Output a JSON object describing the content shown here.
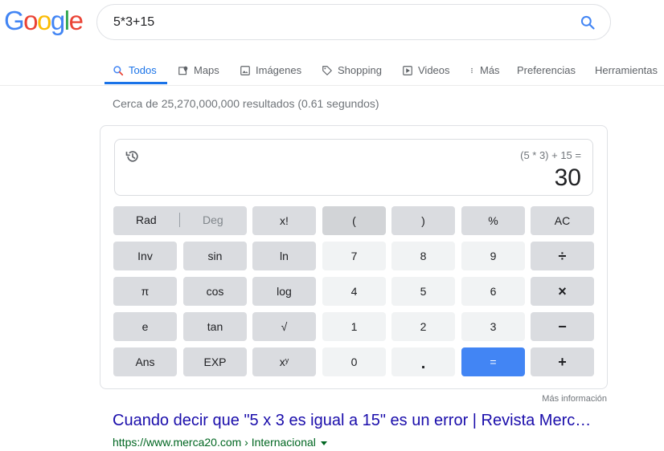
{
  "header": {
    "logo_letters": [
      "G",
      "o",
      "o",
      "g",
      "l",
      "e"
    ],
    "search_value": "5*3+15"
  },
  "tabs": [
    {
      "label": "Todos",
      "icon": "search-icon",
      "active": true
    },
    {
      "label": "Maps",
      "icon": "map-icon"
    },
    {
      "label": "Imágenes",
      "icon": "image-icon"
    },
    {
      "label": "Shopping",
      "icon": "tag-icon"
    },
    {
      "label": "Videos",
      "icon": "play-icon"
    },
    {
      "label": "Más",
      "icon": "more-vertical-icon"
    },
    {
      "label": "Preferencias"
    },
    {
      "label": "Herramientas"
    }
  ],
  "result_stats": "Cerca de 25,270,000,000 resultados (0.61 segundos)",
  "calculator": {
    "expression": "(5 * 3) + 15 =",
    "result": "30",
    "keys": {
      "rad": "Rad",
      "deg": "Deg",
      "fact": "x!",
      "lparen": "(",
      "rparen": ")",
      "percent": "%",
      "ac": "AC",
      "inv": "Inv",
      "sin": "sin",
      "ln": "ln",
      "k7": "7",
      "k8": "8",
      "k9": "9",
      "divide": "÷",
      "pi": "π",
      "cos": "cos",
      "log": "log",
      "k4": "4",
      "k5": "5",
      "k6": "6",
      "multiply": "×",
      "e": "e",
      "tan": "tan",
      "sqrt": "√",
      "k1": "1",
      "k2": "2",
      "k3": "3",
      "minus": "−",
      "ans": "Ans",
      "exp": "EXP",
      "pow_base": "x",
      "pow_exp": "y",
      "k0": "0",
      "dot": ".",
      "equals": "=",
      "plus": "+"
    },
    "more_info": "Más información"
  },
  "result": {
    "title": "Cuando decir que \"5 x 3 es igual a 15\" es un error | Revista Merc…",
    "url": "https://www.merca20.com › Internacional"
  },
  "colors": {
    "accent": "#1a73e8",
    "equals_button": "#4285f4",
    "link": "#1a0dab",
    "url": "#006621"
  }
}
